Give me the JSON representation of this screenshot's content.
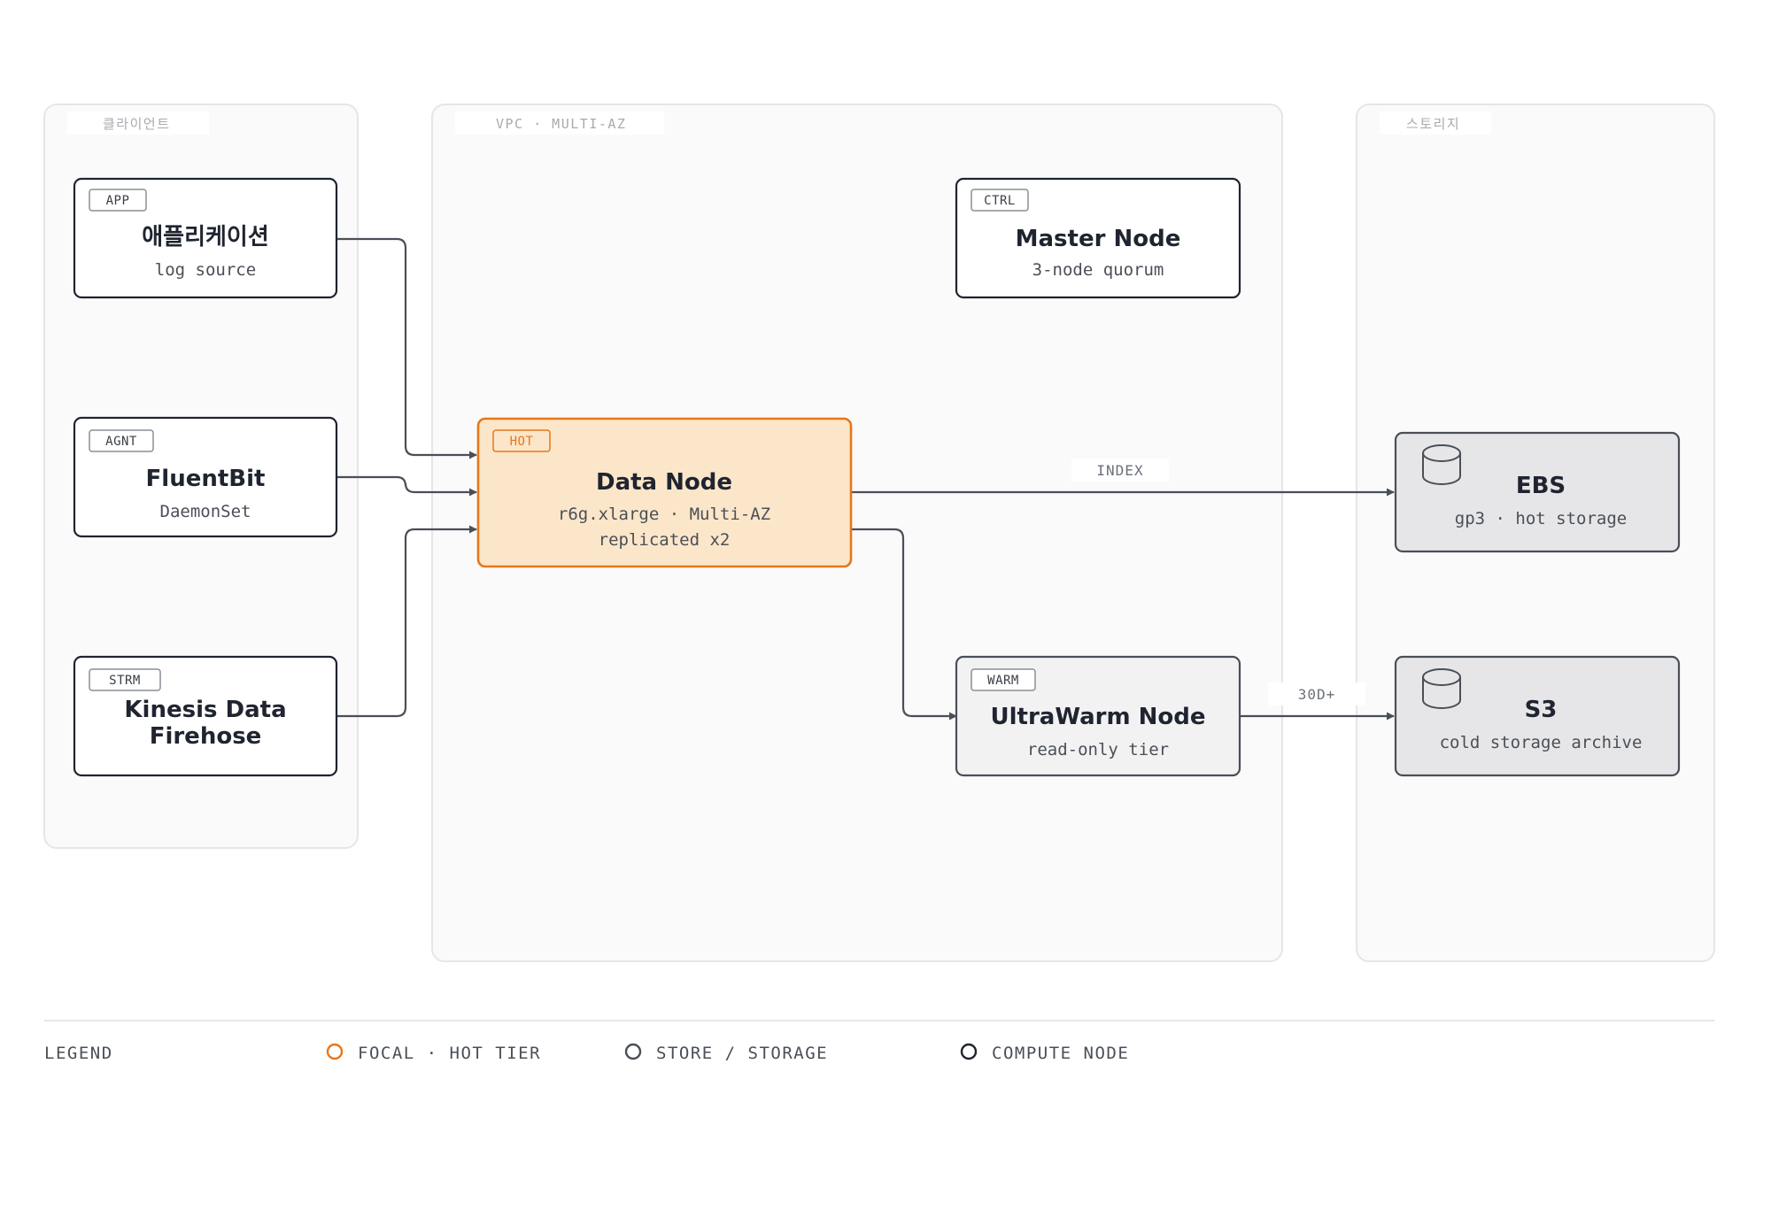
{
  "groups": {
    "clients": {
      "label": "클라이언트"
    },
    "vpc": {
      "label": "VPC · MULTI-AZ"
    },
    "storage": {
      "label": "스토리지"
    }
  },
  "nodes": {
    "app": {
      "tag": "APP",
      "title": "애플리케이션",
      "sub": "log source"
    },
    "fluentbit": {
      "tag": "AGNT",
      "title": "FluentBit",
      "sub": "DaemonSet"
    },
    "kinesis": {
      "tag": "STRM",
      "title_line1": "Kinesis Data",
      "title_line2": "Firehose"
    },
    "datanode": {
      "tag": "HOT",
      "title": "Data Node",
      "sub1": "r6g.xlarge · Multi-AZ",
      "sub2": "replicated x2"
    },
    "master": {
      "tag": "CTRL",
      "title": "Master Node",
      "sub": "3-node quorum"
    },
    "ultrawarm": {
      "tag": "WARM",
      "title": "UltraWarm Node",
      "sub": "read-only tier"
    },
    "ebs": {
      "title": "EBS",
      "sub": "gp3 · hot storage",
      "icon": "database-icon"
    },
    "s3": {
      "title": "S3",
      "sub": "cold storage archive",
      "icon": "database-icon"
    }
  },
  "edges": {
    "index": {
      "label": "INDEX"
    },
    "archive": {
      "label": "30D+"
    }
  },
  "legend": {
    "title": "LEGEND",
    "items": [
      {
        "label": "FOCAL · HOT TIER",
        "color": "#e8761a"
      },
      {
        "label": "STORE / STORAGE",
        "color": "#4a4f57"
      },
      {
        "label": "COMPUTE NODE",
        "color": "#1f2430"
      }
    ]
  },
  "colors": {
    "accent": "#e8761a",
    "accent_fill": "#fbe6c9",
    "node_stroke": "#1f2430",
    "store_fill": "#e6e6e8",
    "edge": "#4a4f57"
  }
}
